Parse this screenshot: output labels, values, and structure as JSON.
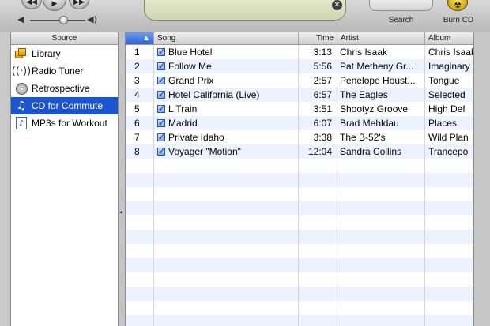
{
  "toolbar": {
    "back_glyph": "◀◀",
    "play_glyph": "▶",
    "forward_glyph": "▶▶",
    "volume_low_glyph": "◀",
    "volume_high_glyph": "◀)",
    "volume_level": 0.6,
    "lcd_close_glyph": "✕",
    "search_label": "Search",
    "burn_label": "Burn CD",
    "burn_glyph": "☢",
    "icons": [
      "previous-icon",
      "play-icon",
      "next-icon",
      "volume-low-icon",
      "volume-high-icon",
      "close-icon",
      "radioactive-icon"
    ]
  },
  "source": {
    "header": "Source",
    "items": [
      {
        "label": "Library",
        "icon": "library-icon",
        "selected": false
      },
      {
        "label": "Radio Tuner",
        "icon": "radio-icon",
        "selected": false
      },
      {
        "label": "Retrospective",
        "icon": "cd-icon",
        "selected": false
      },
      {
        "label": "CD for Commute",
        "icon": "music-note-icon",
        "selected": true
      },
      {
        "label": "MP3s for Workout",
        "icon": "playlist-icon",
        "selected": false
      }
    ]
  },
  "tracks": {
    "columns": {
      "num": "▲",
      "song": "Song",
      "time": "Time",
      "artist": "Artist",
      "album": "Album"
    },
    "rows": [
      {
        "num": "1",
        "song": "Blue Hotel",
        "time": "3:13",
        "artist": "Chris Isaak",
        "album": "Chris Isaak"
      },
      {
        "num": "2",
        "song": "Follow Me",
        "time": "5:56",
        "artist": "Pat Metheny Gr...",
        "album": "Imaginary"
      },
      {
        "num": "3",
        "song": "Grand Prix",
        "time": "2:57",
        "artist": "Penelope Houst...",
        "album": "Tongue"
      },
      {
        "num": "4",
        "song": "Hotel California (Live)",
        "time": "6:57",
        "artist": "The Eagles",
        "album": "Selected"
      },
      {
        "num": "5",
        "song": "L Train",
        "time": "3:51",
        "artist": "Shootyz Groove",
        "album": "High Def"
      },
      {
        "num": "6",
        "song": "Madrid",
        "time": "6:07",
        "artist": "Brad Mehldau",
        "album": "Places"
      },
      {
        "num": "7",
        "song": "Private Idaho",
        "time": "3:38",
        "artist": "The B-52's",
        "album": "Wild Plan"
      },
      {
        "num": "8",
        "song": "Voyager \"Motion\"",
        "time": "12:04",
        "artist": "Sandra Collins",
        "album": "Trancepo"
      }
    ]
  },
  "colors": {
    "selection": "#1b54cf",
    "row_stripe": "#edf3fe",
    "chrome": "#c9c9c9",
    "lcd": "#d8ddbd"
  }
}
